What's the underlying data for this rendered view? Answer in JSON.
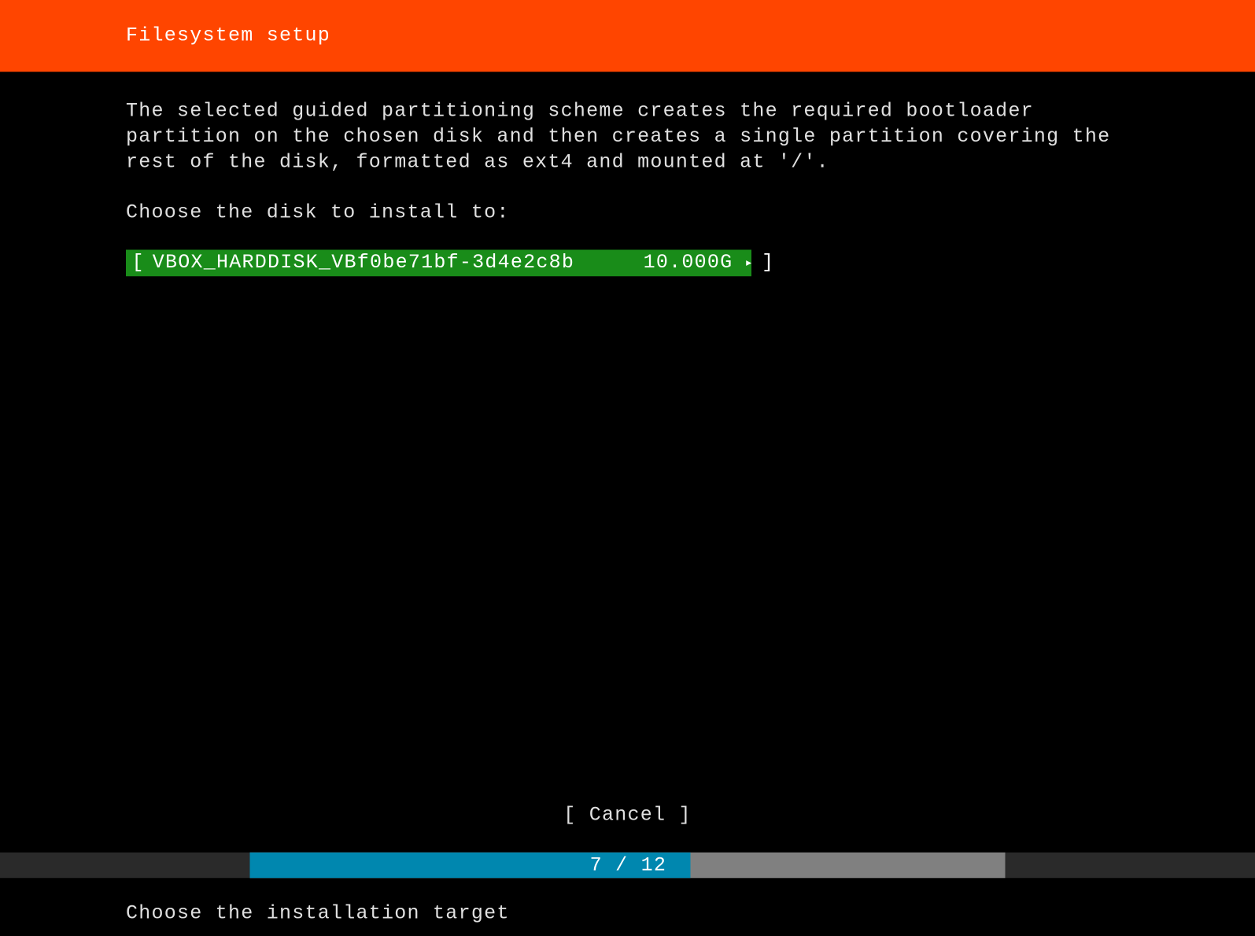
{
  "header": {
    "title": "Filesystem setup"
  },
  "body": {
    "description": "The selected guided partitioning scheme creates the required bootloader\npartition on the chosen disk and then creates a single partition covering the\nrest of the disk, formatted as ext4 and mounted at '/'.",
    "prompt": "Choose the disk to install to:"
  },
  "disks": [
    {
      "bracket_left": "[",
      "name": "VBOX_HARDDISK_VBf0be71bf-3d4e2c8b",
      "size": "10.000G",
      "arrow": "▸",
      "bracket_right": "]"
    }
  ],
  "actions": {
    "cancel_label_full": "[ Cancel      ]"
  },
  "progress": {
    "current": 7,
    "total": 12,
    "label": "7 / 12",
    "fill_percent": 58.3
  },
  "footer": {
    "hint": "Choose the installation target"
  },
  "colors": {
    "header_bg": "#ff4500",
    "selection_bg": "#198c19",
    "progress_fill": "#0087af",
    "progress_track": "#808080",
    "black": "#000000",
    "text": "#e0e0e0"
  }
}
